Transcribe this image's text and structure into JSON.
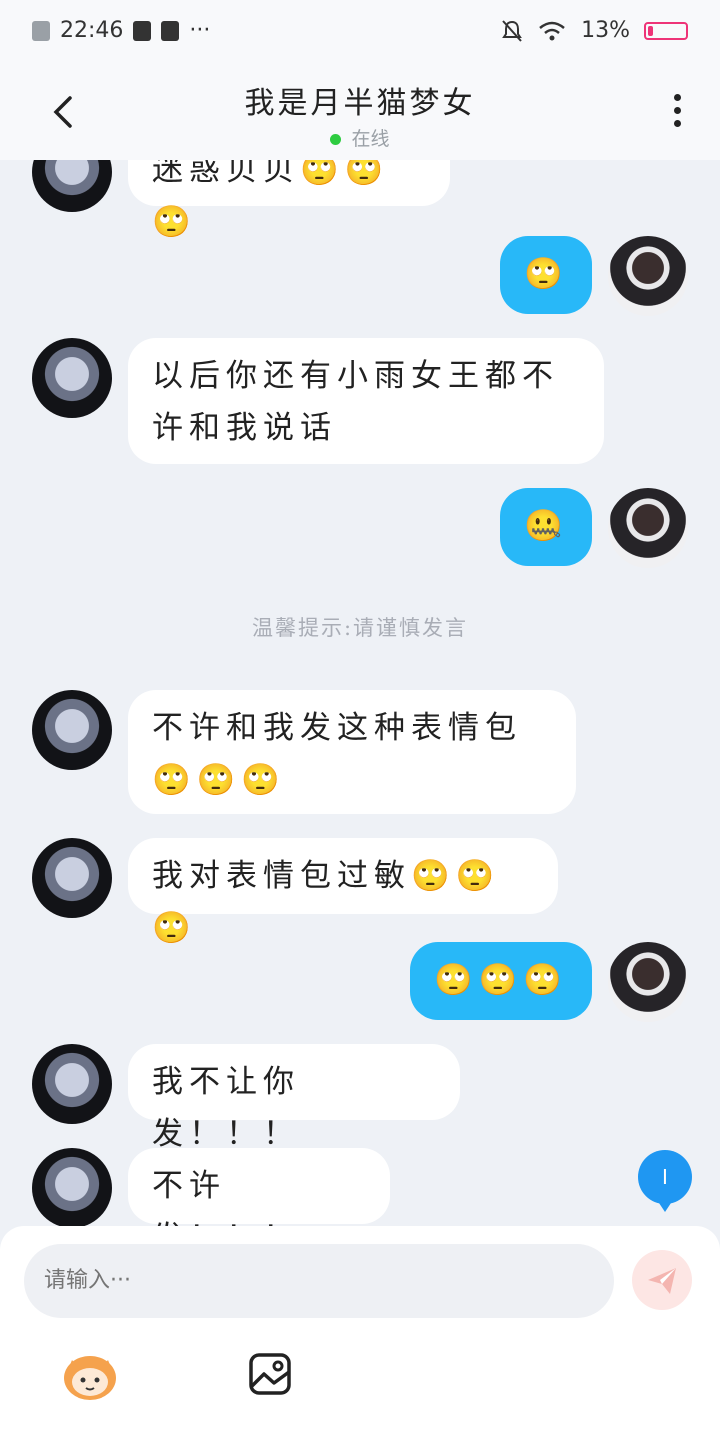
{
  "status_bar": {
    "time": "22:46",
    "more": "···",
    "battery_text": "13%",
    "battery_level": 0.13
  },
  "header": {
    "title": "我是月半猫梦女",
    "status": "在线",
    "back_icon": "chevron-left-icon",
    "more_icon": "more-vertical-icon"
  },
  "messages": [
    {
      "side": "other",
      "text": "迷惑贝贝🙄🙄🙄"
    },
    {
      "side": "me",
      "text": "🙄"
    },
    {
      "side": "other",
      "text": "以后你还有小雨女王都不许和我说话"
    },
    {
      "side": "me",
      "text": "🤐"
    },
    {
      "type": "system",
      "text": "温馨提示:请谨慎发言"
    },
    {
      "side": "other",
      "text": "不许和我发这种表情包🙄🙄🙄"
    },
    {
      "side": "other",
      "text": "我对表情包过敏🙄🙄🙄"
    },
    {
      "side": "me",
      "text": "🙄🙄🙄"
    },
    {
      "side": "other",
      "text": "我不让你发！！！"
    },
    {
      "side": "other",
      "text": "不许发！！！"
    }
  ],
  "new_message_badge": "I",
  "composer": {
    "placeholder": "请输入···",
    "send_icon": "paper-plane-icon",
    "emoji_icon": "emoji-face-icon",
    "image_icon": "image-icon"
  },
  "colors": {
    "accent_bubble": "#28b8f8",
    "online_dot": "#2ecc40",
    "badge_blue": "#1f97f2"
  }
}
